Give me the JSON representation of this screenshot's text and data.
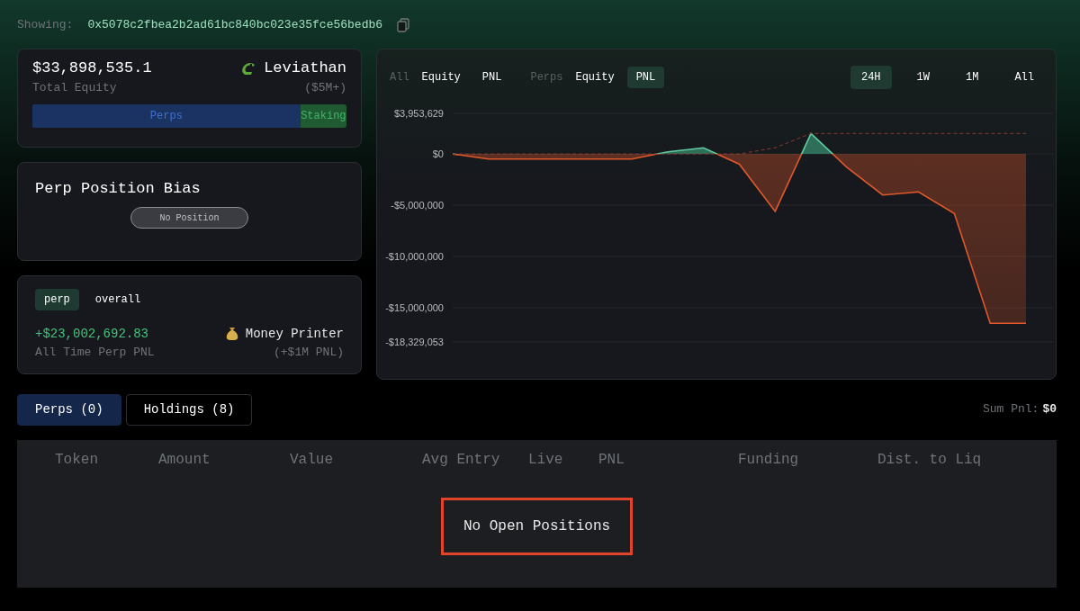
{
  "header": {
    "label": "Showing:",
    "address": "0x5078c2fbea2b2ad61bc840bc023e35fce56bedb6"
  },
  "equity_card": {
    "value": "$33,898,535.1",
    "label": "Total Equity",
    "tier": "Leviathan",
    "tier_range": "($5M+)",
    "split_bar": {
      "level": 0.853,
      "fill_label": "Perps",
      "rest_label": "Staking"
    }
  },
  "bias_card": {
    "title": "Perp Position Bias",
    "status": "No Position"
  },
  "pnl_card": {
    "toggles": [
      {
        "label": "perp",
        "selected": true
      },
      {
        "label": "overall",
        "selected": false
      }
    ],
    "value": "+$23,002,692.83",
    "label": "All Time Perp PNL",
    "tier": "Money Printer",
    "tier_range": "(+$1M PNL)"
  },
  "chart_panel": {
    "groups": [
      {
        "label": "All",
        "options": [
          {
            "label": "Equity",
            "selected": false
          },
          {
            "label": "PNL",
            "selected": false
          }
        ]
      },
      {
        "label": "Perps",
        "options": [
          {
            "label": "Equity",
            "selected": false
          },
          {
            "label": "PNL",
            "selected": true
          }
        ]
      }
    ],
    "ranges": [
      {
        "label": "24H",
        "selected": true
      },
      {
        "label": "1W",
        "selected": false
      },
      {
        "label": "1M",
        "selected": false
      },
      {
        "label": "All",
        "selected": false
      }
    ],
    "chart_data": {
      "type": "area",
      "grid": true,
      "yticks": [
        {
          "value": 3953629,
          "label": "$3,953,629"
        },
        {
          "value": 0,
          "label": "$0"
        },
        {
          "value": -5000000,
          "label": "-$5,000,000"
        },
        {
          "value": -10000000,
          "label": "-$10,000,000"
        },
        {
          "value": -15000000,
          "label": "-$15,000,000"
        },
        {
          "value": -18329053,
          "label": "-$18,329,053"
        }
      ],
      "ylim": [
        -18329053,
        3953629
      ],
      "series": [
        {
          "type": "area",
          "color": "#e0572a",
          "values": [
            0,
            -500000,
            -500000,
            -500000,
            -500000,
            -500000,
            200000,
            600000,
            -1000000,
            -5600000,
            2000000,
            -1300000,
            -4000000,
            -3700000,
            -5800000,
            -16500000,
            -16500000
          ]
        },
        {
          "type": "line",
          "line_style": "dashed",
          "color": "#8a3a34",
          "values": [
            0,
            0,
            0,
            0,
            0,
            0,
            0,
            0,
            0,
            600000,
            2000000,
            2000000,
            2000000,
            2000000,
            2000000,
            2000000,
            2000000
          ]
        }
      ]
    }
  },
  "positions": {
    "tabs": [
      {
        "label": "Perps (0)",
        "selected": true
      },
      {
        "label": "Holdings (8)",
        "selected": false
      }
    ],
    "sum_label": "Sum Pnl:",
    "sum_value": "$0",
    "columns": [
      "Token",
      "Amount",
      "Value",
      "Avg Entry",
      "Live",
      "PNL",
      "Funding",
      "Dist. to Liq"
    ],
    "empty_message": {
      "text": "No Open Positions",
      "highlighted": true
    }
  }
}
